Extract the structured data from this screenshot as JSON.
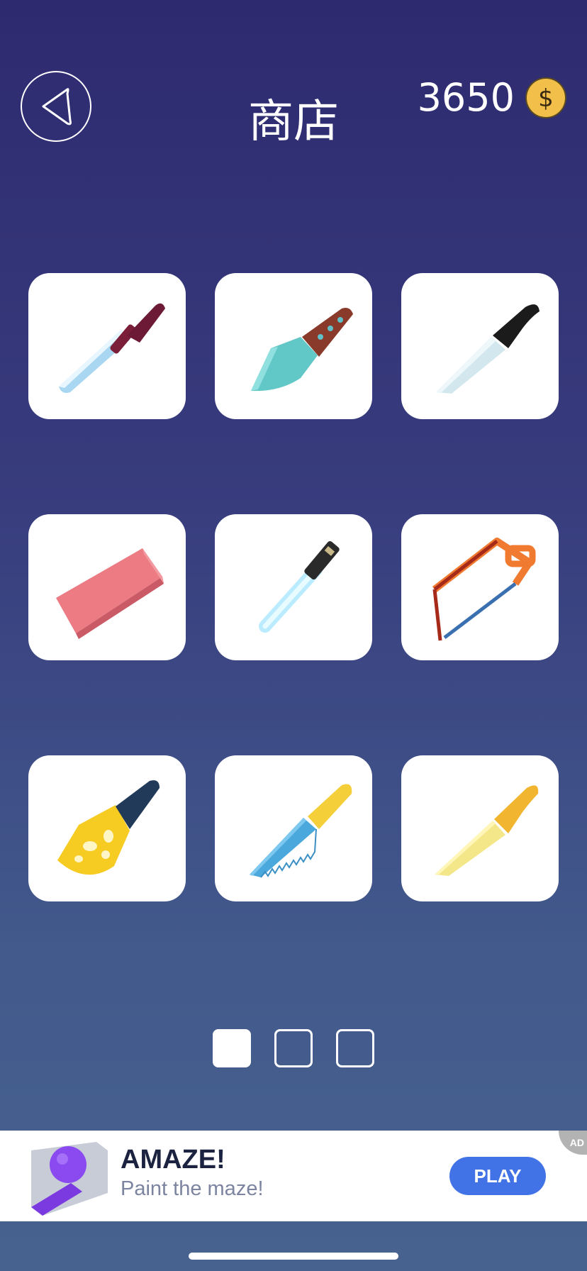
{
  "header": {
    "title": "商店",
    "coin_count": "3650",
    "coin_icon": "dollar-coin-icon",
    "back_icon": "back-triangle-icon"
  },
  "shop_items": [
    {
      "icon": "hunting-knife-icon"
    },
    {
      "icon": "cleaver-knife-icon"
    },
    {
      "icon": "chef-knife-icon"
    },
    {
      "icon": "eraser-blade-icon"
    },
    {
      "icon": "lightsaber-icon"
    },
    {
      "icon": "hacksaw-icon"
    },
    {
      "icon": "cheese-knife-icon"
    },
    {
      "icon": "bread-knife-icon"
    },
    {
      "icon": "yellow-knife-icon"
    }
  ],
  "pager": {
    "pages": 3,
    "current": 1
  },
  "ad": {
    "badge": "AD",
    "title": "AMAZE!",
    "subtitle": "Paint the maze!",
    "button": "PLAY"
  },
  "colors": {
    "background_top": "#2e2a70",
    "background_bottom": "#48628f",
    "coin": "#f2c04a",
    "ad_button": "#4273e6"
  }
}
